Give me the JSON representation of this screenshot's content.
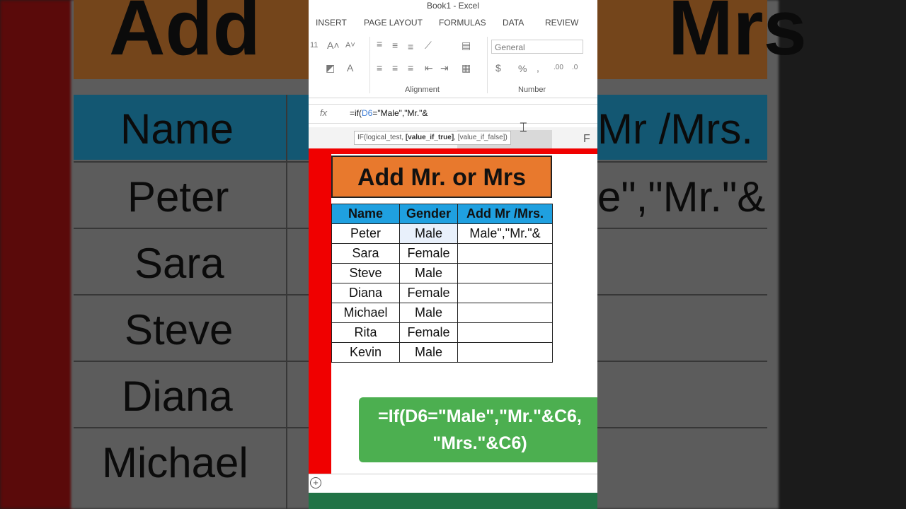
{
  "window": {
    "title": "Book1 - Excel"
  },
  "ribbon": {
    "tabs": [
      "INSERT",
      "PAGE LAYOUT",
      "FORMULAS",
      "DATA",
      "REVIEW"
    ],
    "font_size": "11",
    "number_format": "General",
    "groups": {
      "alignment": "Alignment",
      "number": "Number"
    }
  },
  "formula_bar": {
    "fx_label": "fx",
    "prefix": "=if(",
    "ref": "D6",
    "rest": "=\"Male\",\"Mr.\"&"
  },
  "tooltip": {
    "start": "IF(logical_test, ",
    "bold": "[value_if_true]",
    "end": ", [value_if_false])"
  },
  "column_header": "F",
  "sheet": {
    "title": "Add Mr. or Mrs",
    "headers": [
      "Name",
      "Gender",
      "Add Mr /Mrs."
    ],
    "rows": [
      [
        "Peter",
        "Male",
        "Male\",\"Mr.\"&"
      ],
      [
        "Sara",
        "Female",
        ""
      ],
      [
        "Steve",
        "Male",
        ""
      ],
      [
        "Diana",
        "Female",
        ""
      ],
      [
        "Michael",
        "Male",
        ""
      ],
      [
        "Rita",
        "Female",
        ""
      ],
      [
        "Kevin",
        "Male",
        ""
      ]
    ]
  },
  "callout": {
    "line1": "=If(D6=\"Male\",\"Mr.\"&C6,",
    "line2": "\"Mrs.\"&C6)"
  },
  "background": {
    "title_left": "Add",
    "title_right": "Mrs",
    "header_left": "Name",
    "header_right": "Mr /Mrs.",
    "names": [
      "Peter",
      "Sara",
      "Steve",
      "Diana",
      "Michael"
    ],
    "formula_fragment": "e\",\"Mr.\"&"
  }
}
